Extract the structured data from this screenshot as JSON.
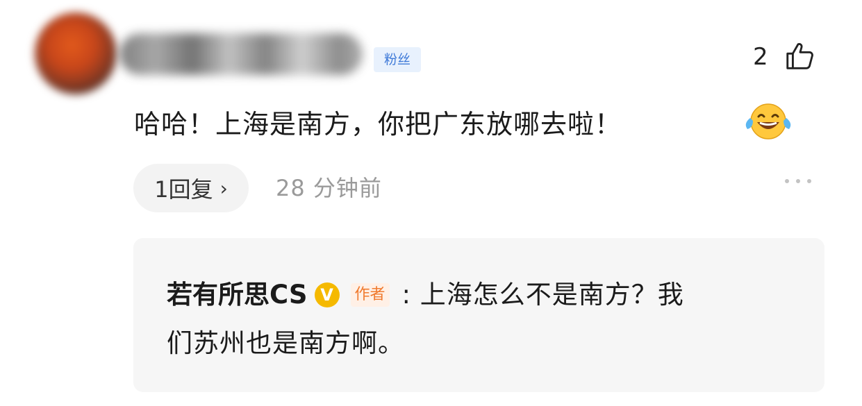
{
  "comment": {
    "fan_badge": "粉丝",
    "like_count": "2",
    "text": "哈哈！上海是南方，你把广东放哪去啦！",
    "emoji": "laughing-tears-emoji",
    "reply_button_label": "1回复",
    "reply_chevron": "›",
    "timestamp": "28 分钟前"
  },
  "reply": {
    "author": "若有所思CS",
    "verified_badge": "V",
    "author_tag": "作者",
    "text_line1": ": 上海怎么不是南方？我",
    "text_line2": "们苏州也是南方啊。"
  },
  "icons": {
    "like": "thumbs-up-icon",
    "more": "more-dots-icon",
    "verified": "verified-badge-icon"
  },
  "colors": {
    "fan_badge_bg": "#e8f1fd",
    "fan_badge_text": "#3f7ad8",
    "verified": "#f5b900",
    "author_tag_text": "#f07a2e",
    "timestamp": "#9a9a9a"
  }
}
